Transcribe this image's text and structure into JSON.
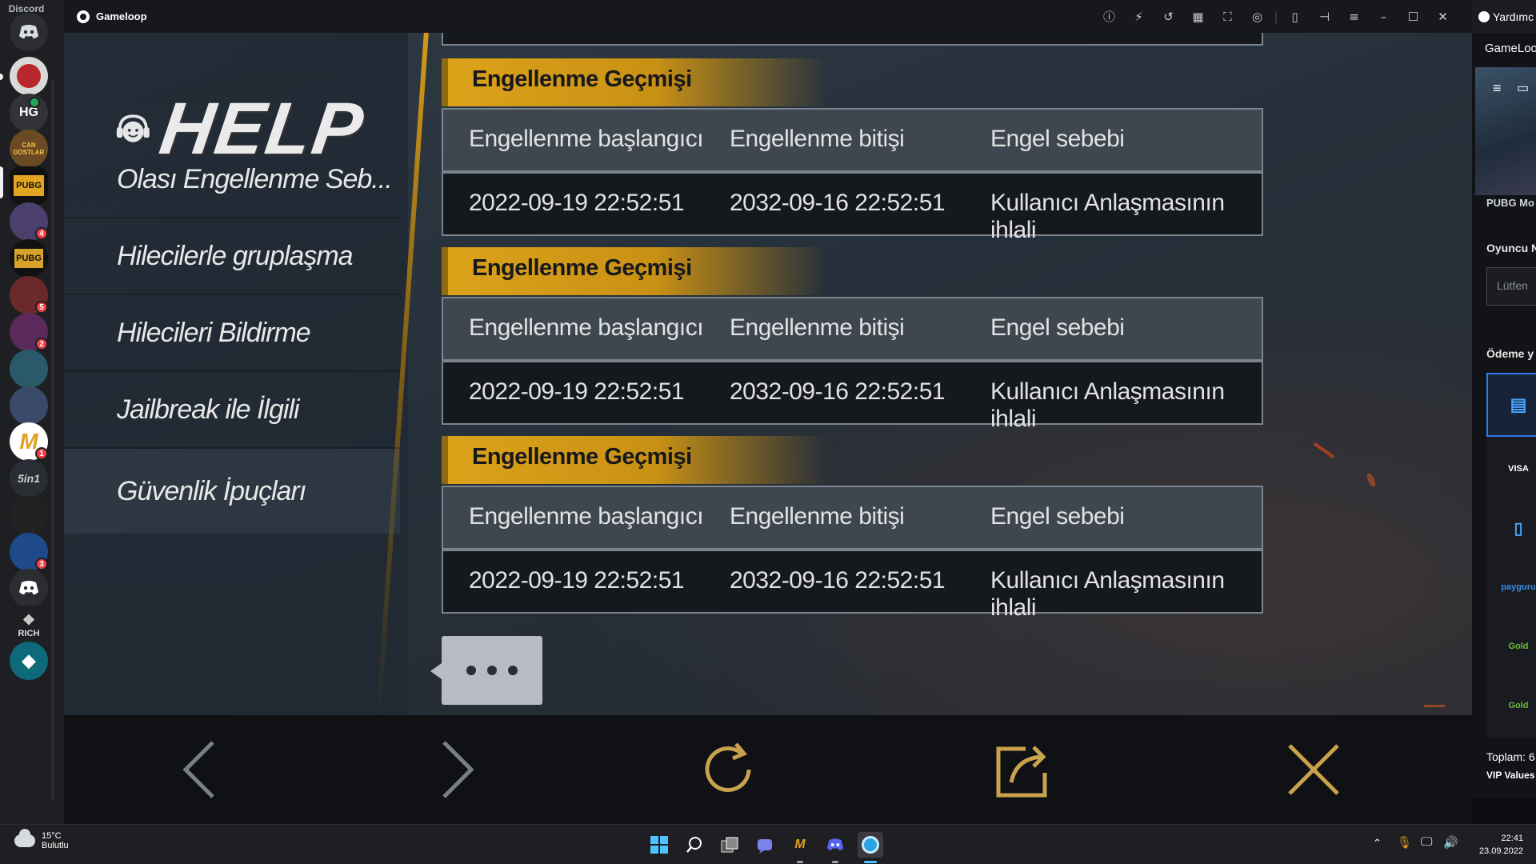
{
  "discord": {
    "brand": "Discord",
    "servers": [
      {
        "name": "discord-home",
        "label": "",
        "bg": "#2b2d31",
        "badge": ""
      },
      {
        "name": "server-1",
        "label": "",
        "bg": "#c9c9c9",
        "badge": ""
      },
      {
        "name": "server-hg",
        "label": "HG",
        "bg": "#313338",
        "badge": ""
      },
      {
        "name": "server-can-dostlar",
        "label": "CAN DOSTLAR",
        "bg": "#7a5a2c",
        "badge": ""
      },
      {
        "name": "server-pubg-turkey",
        "label": "PUBG",
        "bg": "#e0a020",
        "badge": ""
      },
      {
        "name": "server-5",
        "label": "",
        "bg": "#4b3f6b",
        "badge": "4"
      },
      {
        "name": "server-pubg-mobile",
        "label": "PUBG",
        "bg": "#caa128",
        "badge": ""
      },
      {
        "name": "server-7",
        "label": "",
        "bg": "#6b2a2a",
        "badge": "5"
      },
      {
        "name": "server-8",
        "label": "",
        "bg": "#5a2a5a",
        "badge": "2"
      },
      {
        "name": "server-9",
        "label": "",
        "bg": "#2a5a6a",
        "badge": ""
      },
      {
        "name": "server-10",
        "label": "",
        "bg": "#3a4a6a",
        "badge": ""
      },
      {
        "name": "server-11",
        "label": "M",
        "bg": "#a02020",
        "badge": "1"
      },
      {
        "name": "server-5in1",
        "label": "5in1",
        "bg": "#2a2d33",
        "badge": ""
      },
      {
        "name": "server-13",
        "label": "",
        "bg": "#222",
        "badge": ""
      },
      {
        "name": "server-14",
        "label": "",
        "bg": "#1e4a8a",
        "badge": "3"
      },
      {
        "name": "server-15",
        "label": "",
        "bg": "#2b2d31",
        "badge": ""
      },
      {
        "name": "server-rich",
        "label": "RICH",
        "bg": "#1e1f22",
        "badge": ""
      },
      {
        "name": "server-17",
        "label": "",
        "bg": "#0e6a7a",
        "badge": ""
      }
    ]
  },
  "gameloop": {
    "title": "Gameloop",
    "toolbar_icons": [
      "help-icon",
      "boost-icon",
      "rotate-icon",
      "keymap-icon",
      "fullscreen-icon",
      "screenshot-icon",
      "sidebar-icon",
      "pin-icon",
      "menu-icon",
      "minimize-icon",
      "maximize-icon",
      "close-icon"
    ]
  },
  "help": {
    "logo_text": "HELP",
    "menu": [
      "Olası Engellenme Seb...",
      "Hilecilerle gruplaşma",
      "Hilecileri Bildirme",
      "Jailbreak ile İlgili",
      "Güvenlik İpuçları"
    ]
  },
  "records": [
    {
      "section_title": "Engellenme Geçmişi",
      "headers": [
        "Engellenme başlangıcı",
        "Engellenme bitişi",
        "Engel sebebi"
      ],
      "values": [
        "2022-09-19 22:52:51",
        "2032-09-16 22:52:51",
        "Kullanıcı Anlaşmasının ihlali"
      ]
    },
    {
      "section_title": "Engellenme Geçmişi",
      "headers": [
        "Engellenme başlangıcı",
        "Engellenme bitişi",
        "Engel sebebi"
      ],
      "values": [
        "2022-09-19 22:52:51",
        "2032-09-16 22:52:51",
        "Kullanıcı Anlaşmasının ihlali"
      ]
    },
    {
      "section_title": "Engellenme Geçmişi",
      "headers": [
        "Engellenme başlangıcı",
        "Engellenme bitişi",
        "Engel sebebi"
      ],
      "values": [
        "2022-09-19 22:52:51",
        "2032-09-16 22:52:51",
        "Kullanıcı Anlaşmasının ihlali"
      ]
    }
  ],
  "right_panel": {
    "top_title": "Yardımc",
    "tab": "GameLoop",
    "game_label": "PUBG Mo",
    "player_label": "Oyuncu N",
    "input_placeholder": "Lütfen",
    "payment_label": "Ödeme y",
    "payments": [
      "",
      "VISA",
      "",
      "payguru",
      "Gold",
      "Gold"
    ],
    "total_label": "Toplam: 6",
    "vip": "VIP Values"
  },
  "taskbar": {
    "weather_temp": "15°C",
    "weather_desc": "Bulutlu",
    "time": "22:41",
    "date": "23.09.2022"
  },
  "colors": {
    "gold": "#d9a01a",
    "discord_red": "#f23f43"
  }
}
